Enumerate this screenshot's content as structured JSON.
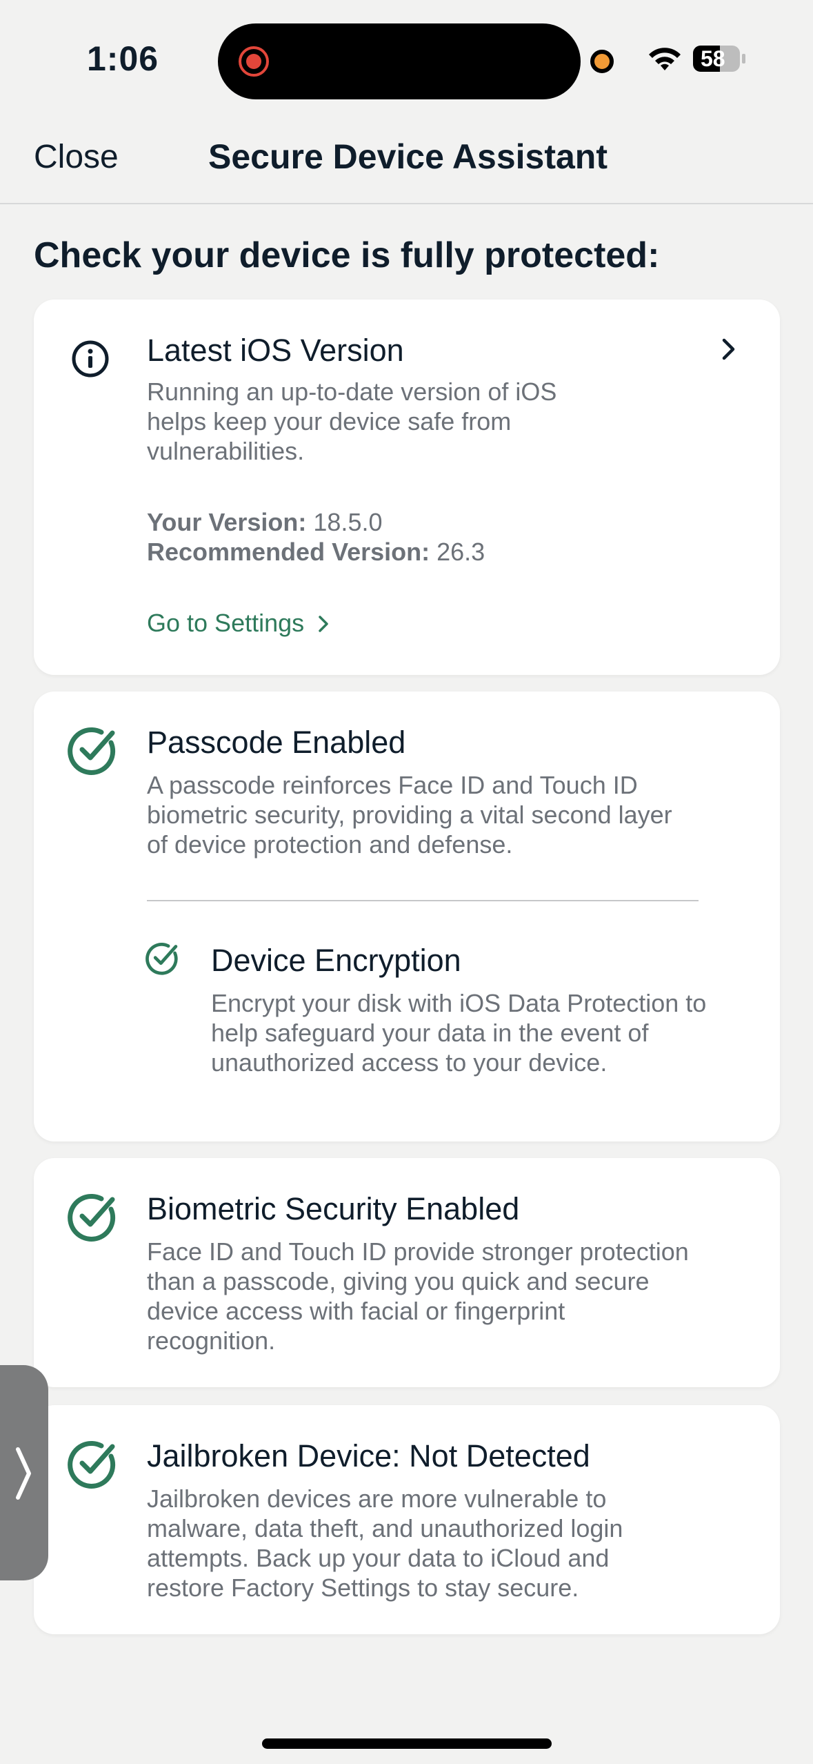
{
  "status_bar": {
    "time": "1:06",
    "battery": "58"
  },
  "nav": {
    "close_label": "Close",
    "title": "Secure Device Assistant"
  },
  "heading": "Check your device is fully protected:",
  "cards": {
    "ios": {
      "title": "Latest iOS Version",
      "desc": "Running an up-to-date version of iOS helps keep your device safe from vulnerabilities.",
      "your_version_label": "Your Version:",
      "your_version_value": " 18.5.0",
      "recommended_label": "Recommended Version:",
      "recommended_value": " 26.3",
      "link_label": "Go to Settings"
    },
    "passcode": {
      "title": "Passcode Enabled",
      "desc": "A passcode reinforces Face ID and Touch ID biometric security, providing a vital second layer of device protection and defense."
    },
    "encryption": {
      "title": "Device Encryption",
      "desc": "Encrypt your disk with iOS Data Protection to help safeguard your data in the event of unauthorized access to your device."
    },
    "biometric": {
      "title": "Biometric Security Enabled",
      "desc": "Face ID and Touch ID provide stronger protection than a passcode, giving you quick and secure device access with facial or fingerprint recognition."
    },
    "jailbreak": {
      "title": "Jailbroken Device: Not Detected",
      "desc": "Jailbroken devices are more vulnerable to malware, data theft, and unauthorized login attempts. Back up your data to iCloud and restore Factory Settings to stay secure."
    }
  },
  "colors": {
    "accent_green": "#2e7a5b",
    "text_primary": "#0f1d2b",
    "text_secondary": "#6c7178",
    "background": "#f2f2f1"
  },
  "icons": [
    "record-icon",
    "wifi-icon",
    "battery-icon",
    "info-icon",
    "chevron-right-icon",
    "check-circle-icon"
  ]
}
